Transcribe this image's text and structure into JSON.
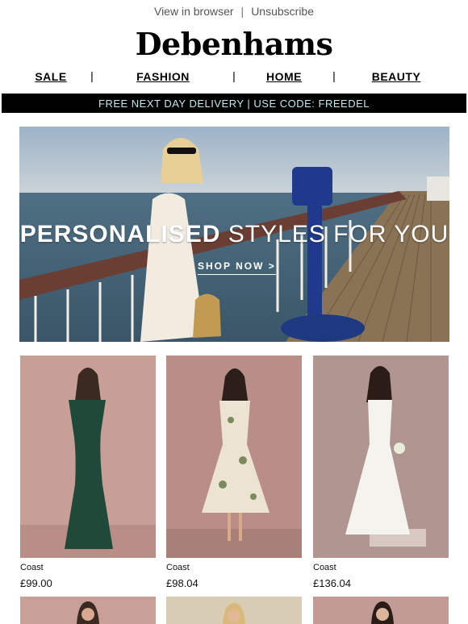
{
  "topbar": {
    "view_browser": "View in browser",
    "separator": "|",
    "unsubscribe": "Unsubscribe"
  },
  "brand": {
    "logo": "Debenhams"
  },
  "nav": {
    "items": [
      {
        "label": "SALE"
      },
      {
        "label": "FASHION"
      },
      {
        "label": "HOME"
      },
      {
        "label": "BEAUTY"
      }
    ],
    "divider": "|"
  },
  "promo": {
    "text": "FREE NEXT DAY DELIVERY | USE CODE: FREEDEL"
  },
  "hero": {
    "headline_bold": "PERSONALISED",
    "headline_rest": " STYLES FOR YOU",
    "cta": "SHOP NOW >"
  },
  "products": [
    {
      "brand": "Coast",
      "price": "£99.00",
      "dress_color": "#1f4a3a",
      "bg": "#c79f97"
    },
    {
      "brand": "Coast",
      "price": "£98.04",
      "dress_color": "#ece3d2",
      "bg": "#b98e86"
    },
    {
      "brand": "Coast",
      "price": "£136.04",
      "dress_color": "#f5f3ee",
      "bg": "#b09590"
    }
  ],
  "colors": {
    "promo_bg": "#000000",
    "promo_text": "#bfe9ea"
  }
}
